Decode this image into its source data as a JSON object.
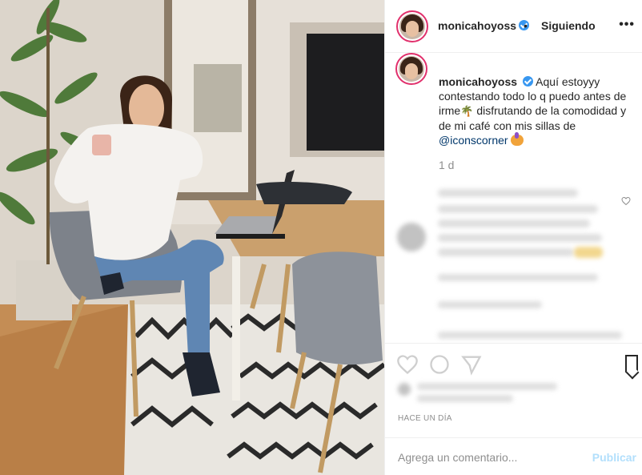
{
  "post": {
    "username": "monicahoyoss",
    "separator": "•",
    "follow_state": "Siguiendo",
    "more_icon": "more-dots-icon",
    "caption_text_1": "Aquí estoyyy contestando todo lo q puedo antes de irme",
    "caption_text_2": "disfrutando de la comodidad y de mi café con mis sillas de",
    "caption_mention": "@iconscorner",
    "caption_time": "1 d",
    "date": "HACE UN DÍA"
  },
  "comment_box": {
    "placeholder": "Agrega un comentario...",
    "publish_label": "Publicar"
  },
  "colors": {
    "verified": "#3897f0",
    "story_ring": "#e1306c",
    "publish_disabled": "#b2dffc",
    "secondary_text": "#8e8e8e"
  }
}
